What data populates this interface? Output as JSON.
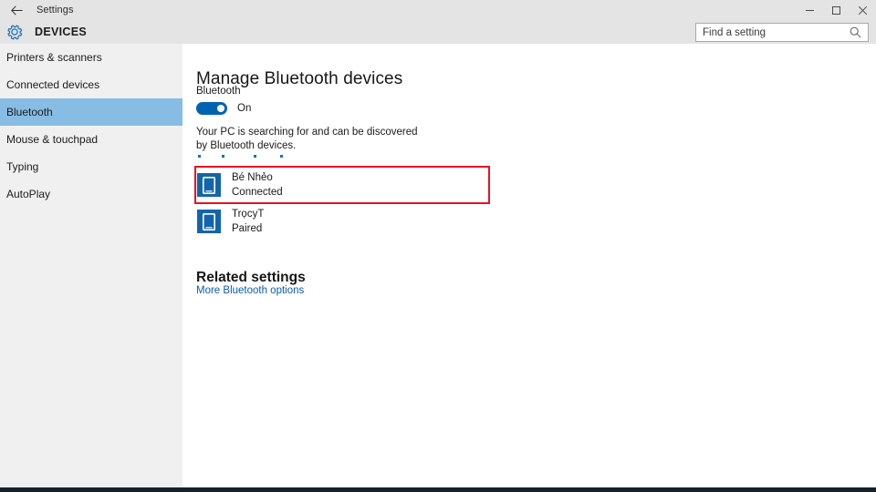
{
  "window": {
    "title": "Settings",
    "back_icon": "back-arrow-icon",
    "controls": {
      "minimize": "minimize-icon",
      "maximize": "maximize-icon",
      "close": "close-icon"
    }
  },
  "header": {
    "title": "DEVICES",
    "icon": "gear-icon",
    "search": {
      "placeholder": "Find a setting",
      "value": "",
      "icon": "search-icon"
    }
  },
  "sidebar": {
    "items": [
      {
        "label": "Printers & scanners",
        "selected": false
      },
      {
        "label": "Connected devices",
        "selected": false
      },
      {
        "label": "Bluetooth",
        "selected": true
      },
      {
        "label": "Mouse & touchpad",
        "selected": false
      },
      {
        "label": "Typing",
        "selected": false
      },
      {
        "label": "AutoPlay",
        "selected": false
      }
    ],
    "selected_color": "#87bde4",
    "background_color": "#f0f0f0"
  },
  "main": {
    "page_title": "Manage Bluetooth devices",
    "bluetooth": {
      "label": "Bluetooth",
      "toggle_state": "On",
      "toggle_on": true,
      "toggle_color": "#0063b1"
    },
    "status_text": "Your PC is searching for and can be discovered by Bluetooth devices.",
    "progress_dots": 4,
    "devices": [
      {
        "name": "Bé Nhẻo",
        "status": "Connected",
        "icon": "phone-icon",
        "highlighted": true
      },
      {
        "name": "TrọcyT",
        "status": "Paired",
        "icon": "phone-icon",
        "highlighted": false
      }
    ],
    "related": {
      "title": "Related settings",
      "link_label": "More Bluetooth options",
      "link_color": "#0a5dad"
    },
    "highlight_color": "#e81123"
  }
}
